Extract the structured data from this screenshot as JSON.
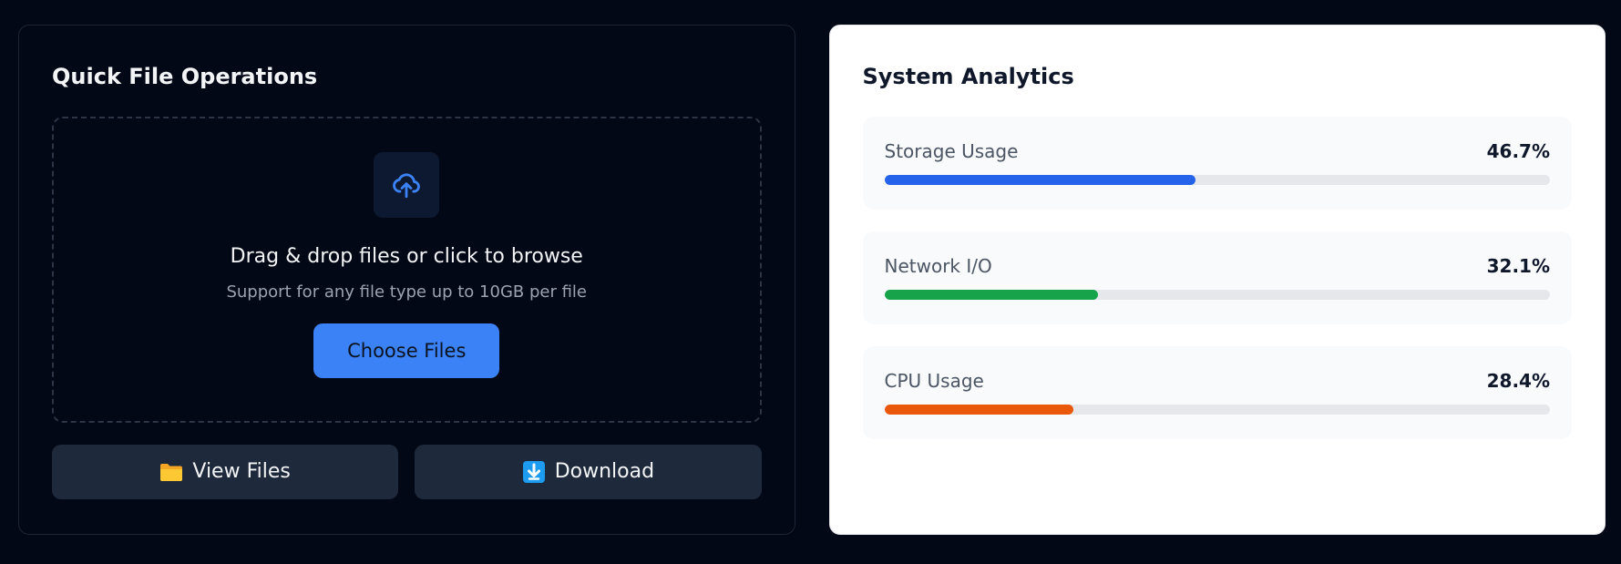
{
  "file_ops": {
    "title": "Quick File Operations",
    "upload_icon": "cloud-upload-icon",
    "drop_title": "Drag & drop files or click to browse",
    "drop_subtitle": "Support for any file type up to 10GB per file",
    "choose_label": "Choose Files",
    "view_files": {
      "icon": "folder-icon",
      "label": "View Files"
    },
    "download": {
      "icon": "download-icon",
      "label": "Download"
    }
  },
  "analytics": {
    "title": "System Analytics",
    "metrics": [
      {
        "label": "Storage Usage",
        "value": "46.7%",
        "percent": 46.7,
        "color": "#2563eb"
      },
      {
        "label": "Network I/O",
        "value": "32.1%",
        "percent": 32.1,
        "color": "#16a34a"
      },
      {
        "label": "CPU Usage",
        "value": "28.4%",
        "percent": 28.4,
        "color": "#ea580c"
      }
    ]
  },
  "colors": {
    "page_bg": "#030816",
    "primary": "#3b82f6",
    "secondary_button": "#1e293b"
  }
}
